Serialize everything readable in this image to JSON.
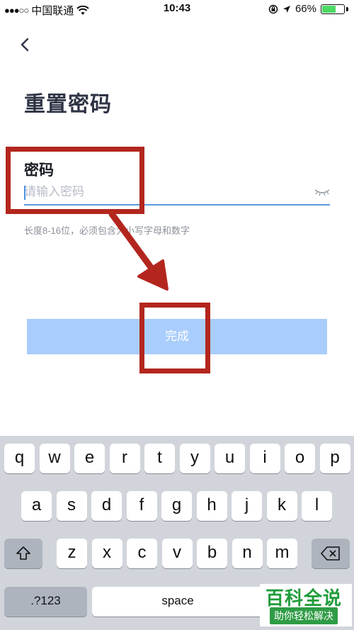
{
  "status_bar": {
    "signal": "●●●○○",
    "carrier": "中国联通",
    "time": "10:43",
    "battery_percent": "66%",
    "battery_level": 0.66
  },
  "page": {
    "title": "重置密码"
  },
  "form": {
    "password_label": "密码",
    "password_placeholder": "请输入密码",
    "password_value": "",
    "hint": "长度8-16位，必须包含大小写字母和数字",
    "submit_label": "完成"
  },
  "keyboard": {
    "row1": [
      "q",
      "w",
      "e",
      "r",
      "t",
      "y",
      "u",
      "i",
      "o",
      "p"
    ],
    "row2": [
      "a",
      "s",
      "d",
      "f",
      "g",
      "h",
      "j",
      "k",
      "l"
    ],
    "row3": [
      "z",
      "x",
      "c",
      "v",
      "b",
      "n",
      "m"
    ],
    "numbers_key": ".?123",
    "space_key": "space",
    "shift_icon": "shift-icon",
    "delete_icon": "delete-icon"
  },
  "watermark": {
    "title": "百科全说",
    "subtitle": "助你轻松解决"
  },
  "colors": {
    "accent": "#5a9be0",
    "button_disabled": "#a9cdfc",
    "annotation": "#b3261e",
    "battery": "#4cd964",
    "keyboard_bg": "#d1d5db"
  }
}
